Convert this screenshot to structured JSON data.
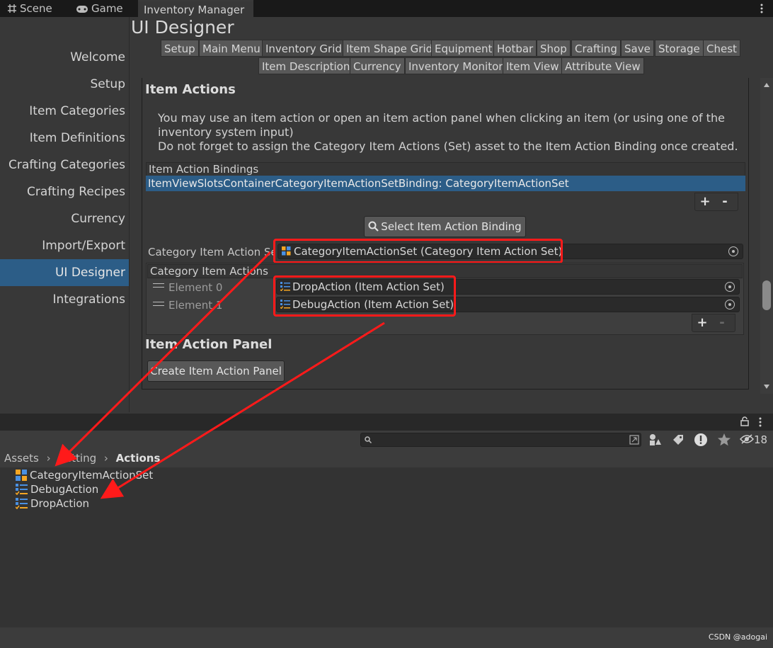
{
  "tabs": [
    {
      "label": "Scene",
      "icon": "grid-icon"
    },
    {
      "label": "Game",
      "icon": "gamepad-icon"
    },
    {
      "label": "Inventory Manager",
      "active": true
    }
  ],
  "sidebar": {
    "items": [
      {
        "label": "Welcome"
      },
      {
        "label": "Setup"
      },
      {
        "label": "Item Categories"
      },
      {
        "label": "Item Definitions"
      },
      {
        "label": "Crafting Categories"
      },
      {
        "label": "Crafting Recipes"
      },
      {
        "label": "Currency"
      },
      {
        "label": "Import/Export"
      },
      {
        "label": "UI Designer",
        "selected": true
      },
      {
        "label": "Integrations"
      }
    ]
  },
  "header": {
    "title": "UI Designer",
    "menu_row1": [
      "Setup",
      "Main Menu",
      "Inventory Grid",
      "Item Shape Grid",
      "Equipment",
      "Hotbar",
      "Shop",
      "Crafting",
      "Save",
      "Storage",
      "Chest"
    ],
    "menu_row2": [
      "Item Description",
      "Currency",
      "Inventory Monitor",
      "Item View",
      "Attribute View"
    ],
    "selected_menu": "Inventory Grid"
  },
  "item_actions": {
    "heading": "Item Actions",
    "description_line1": "You may use an item action or open an item action panel when clicking an item (or using one of the",
    "description_line2": "inventory system input)",
    "description_line3": "Do not forget to assign the Category Item Actions (Set) asset to the Item Action Binding once created.",
    "bindings_header": "Item Action Bindings",
    "binding_selected": "ItemViewSlotsContainerCategoryItemActionSetBinding: CategoryItemActionSet",
    "plus": "+",
    "minus": "-",
    "select_button": "Select Item Action Binding",
    "set_label": "Category Item Action Set",
    "set_value": "CategoryItemActionSet (Category Item Action Set)",
    "list_header": "Category Item Actions",
    "elements": [
      {
        "label": "Element 0",
        "value": "DropAction (Item Action Set)"
      },
      {
        "label": "Element 1",
        "value": "DebugAction (Item Action Set)"
      }
    ]
  },
  "item_action_panel": {
    "heading": "Item Action Panel",
    "create_button": "Create Item Action Panel"
  },
  "project": {
    "hidden_count": "18",
    "breadcrumb": [
      "Assets",
      "Setting",
      "Actions"
    ],
    "assets": [
      {
        "name": "CategoryItemActionSet",
        "icon": "category-set-icon"
      },
      {
        "name": "DebugAction",
        "icon": "action-set-icon"
      },
      {
        "name": "DropAction",
        "icon": "action-set-icon"
      }
    ]
  },
  "watermark": "CSDN @adogai",
  "colors": {
    "selection": "#2c5d87",
    "highlight": "#ff1a1a",
    "background": "#383838"
  }
}
